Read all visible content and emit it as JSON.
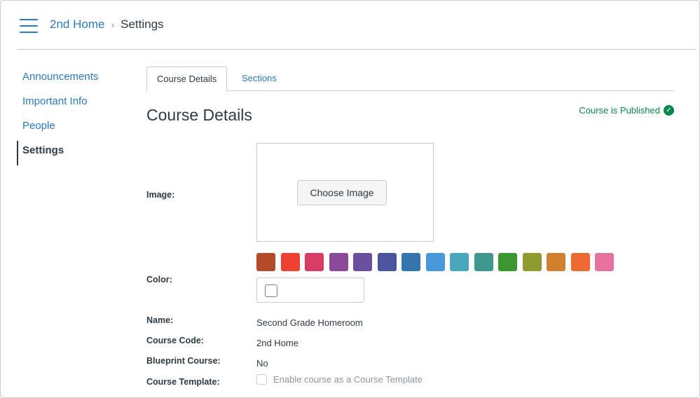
{
  "header": {
    "breadcrumb_home": "2nd Home",
    "breadcrumb_separator": "›",
    "breadcrumb_current": "Settings"
  },
  "sidebar": {
    "items": [
      {
        "label": "Announcements"
      },
      {
        "label": "Important Info"
      },
      {
        "label": "People"
      },
      {
        "label": "Settings"
      }
    ]
  },
  "tabs": [
    {
      "label": "Course Details"
    },
    {
      "label": "Sections"
    }
  ],
  "main": {
    "title": "Course Details",
    "status": "Course is Published",
    "status_icon": "checkmark-circle-icon",
    "image_label": "Image:",
    "choose_image_label": "Choose Image",
    "color_label": "Color:",
    "colors": [
      "#b34a2a",
      "#ee4130",
      "#d83b64",
      "#8a4a97",
      "#6b4e9d",
      "#4b559e",
      "#3574ad",
      "#4899d9",
      "#4aa6ba",
      "#3f968c",
      "#3b962f",
      "#8f9a31",
      "#d2802e",
      "#ec6a32",
      "#e5739e"
    ],
    "name_label": "Name:",
    "name_value": "Second Grade Homeroom",
    "course_code_label": "Course Code:",
    "course_code_value": "2nd Home",
    "blueprint_label": "Blueprint Course:",
    "blueprint_value": "No",
    "template_label": "Course Template:",
    "template_checkbox_label": "Enable course as a Course Template"
  }
}
